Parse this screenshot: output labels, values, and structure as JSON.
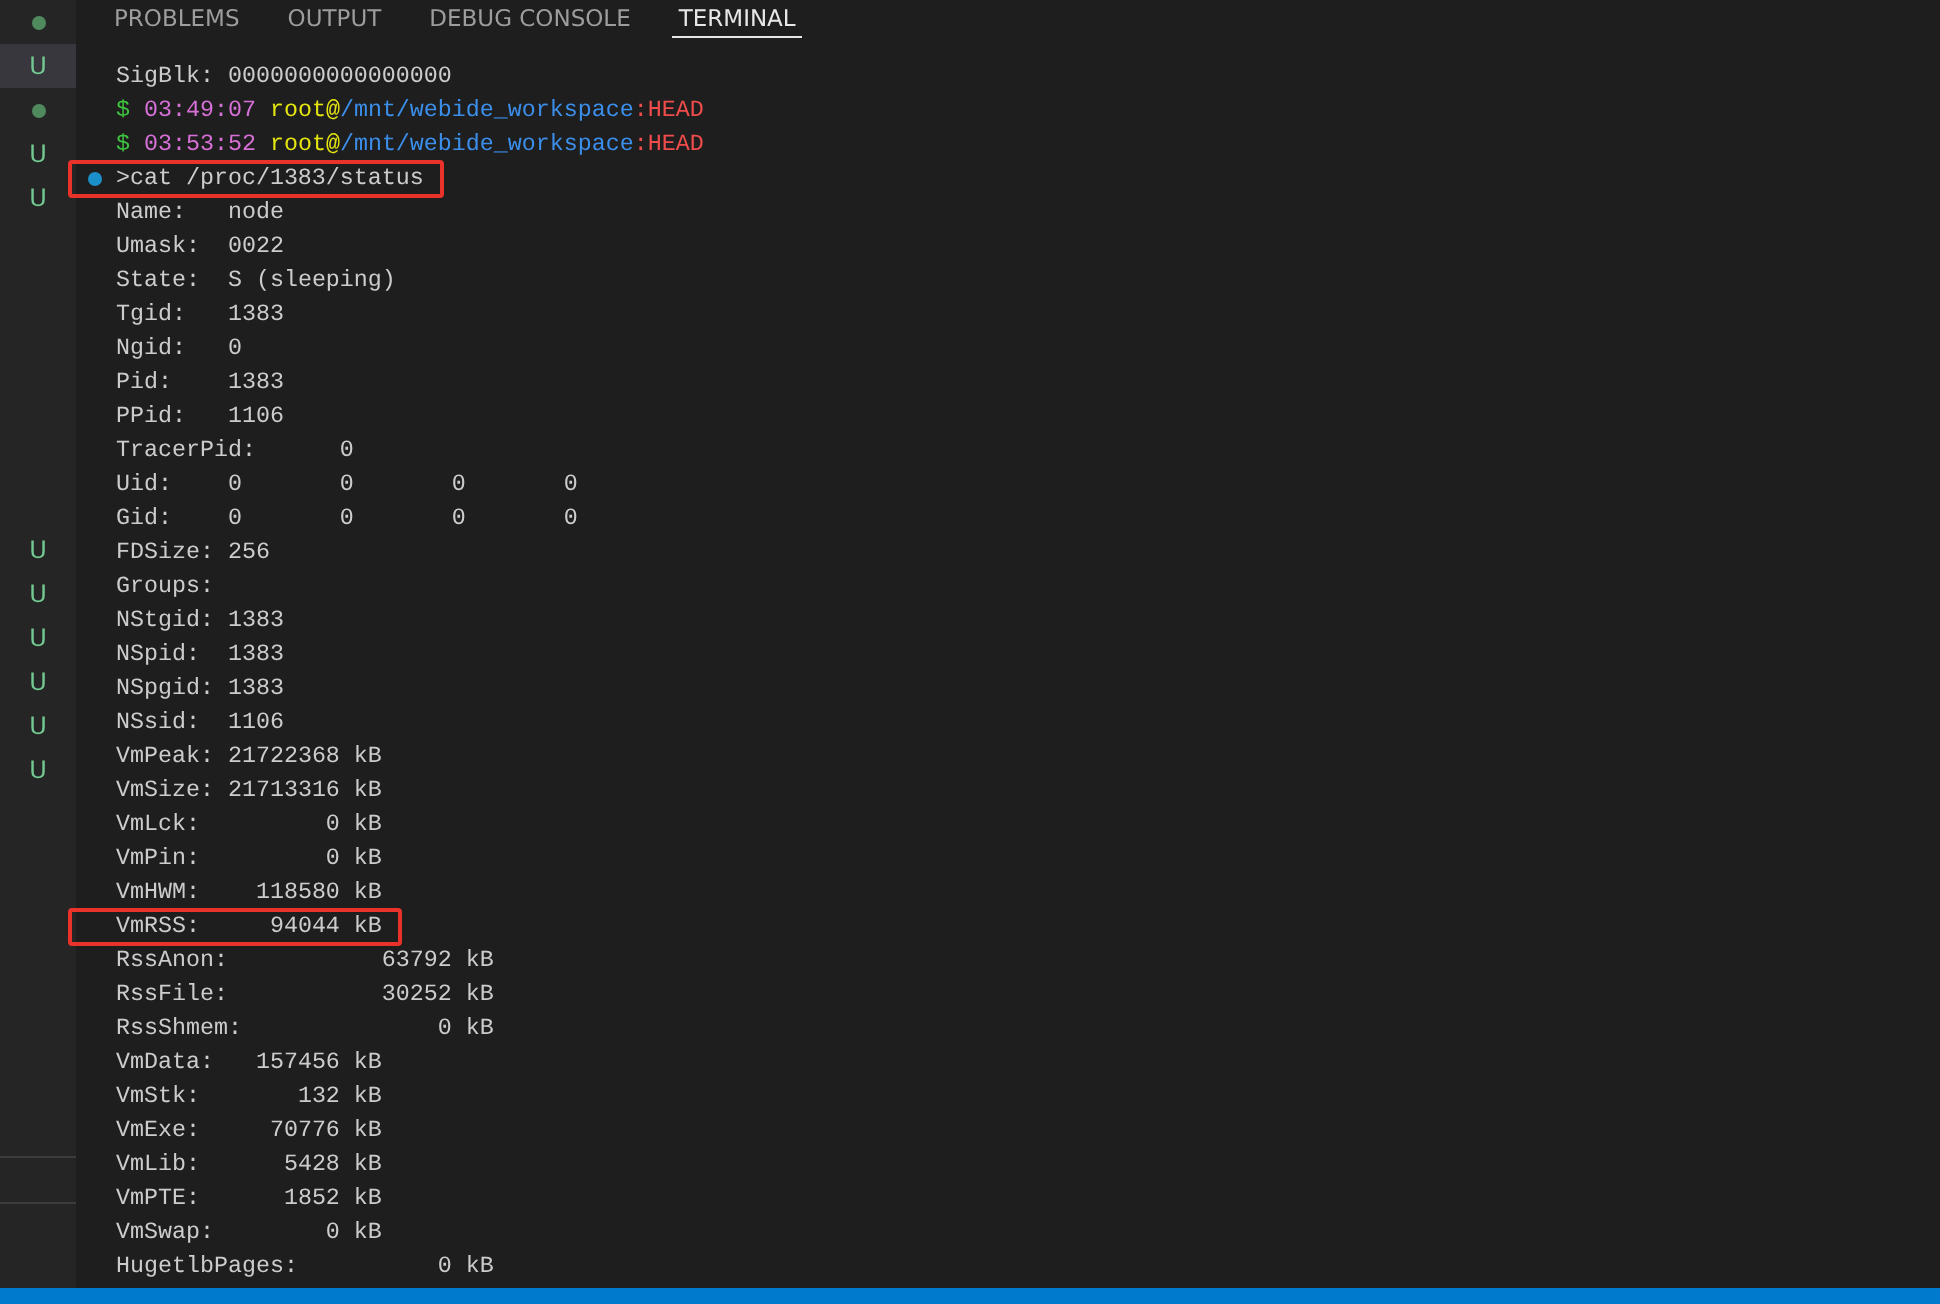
{
  "sidebar": {
    "groups": [
      {
        "items": [
          {
            "kind": "dot",
            "selected": false
          },
          {
            "kind": "letter",
            "text": "U",
            "selected": true
          },
          {
            "kind": "dot",
            "selected": false
          },
          {
            "kind": "letter",
            "text": "U",
            "selected": false
          },
          {
            "kind": "letter",
            "text": "U",
            "selected": false
          }
        ]
      },
      {
        "items": [
          {
            "kind": "letter",
            "text": "U",
            "selected": false
          },
          {
            "kind": "letter",
            "text": "U",
            "selected": false
          },
          {
            "kind": "letter",
            "text": "U",
            "selected": false
          },
          {
            "kind": "letter",
            "text": "U",
            "selected": false
          },
          {
            "kind": "letter",
            "text": "U",
            "selected": false
          },
          {
            "kind": "letter",
            "text": "U",
            "selected": false
          }
        ]
      }
    ]
  },
  "tabs": [
    {
      "label": "PROBLEMS",
      "selected": false
    },
    {
      "label": "OUTPUT",
      "selected": false
    },
    {
      "label": "DEBUG CONSOLE",
      "selected": false
    },
    {
      "label": "TERMINAL",
      "selected": true
    }
  ],
  "terminal": {
    "lines": [
      {
        "kind": "text",
        "text": "SigBlk:\t0000000000000000",
        "highlighted": false
      },
      {
        "kind": "prompt",
        "segments": [
          {
            "text": "$ ",
            "color": "#3fc43f"
          },
          {
            "text": "03:49:07 ",
            "color": "#d670d6"
          },
          {
            "text": "root@",
            "color": "#e5e510"
          },
          {
            "text": "/mnt/webide_workspace",
            "color": "#3b8eea"
          },
          {
            "text": ":HEAD",
            "color": "#f14c4c"
          }
        ],
        "highlighted": false
      },
      {
        "kind": "prompt",
        "segments": [
          {
            "text": "$ ",
            "color": "#3fc43f"
          },
          {
            "text": "03:53:52 ",
            "color": "#d670d6"
          },
          {
            "text": "root@",
            "color": "#e5e510"
          },
          {
            "text": "/mnt/webide_workspace",
            "color": "#3b8eea"
          },
          {
            "text": ":HEAD",
            "color": "#f14c4c"
          }
        ],
        "highlighted": false
      },
      {
        "kind": "command",
        "text": ">cat /proc/1383/status",
        "highlighted": true
      },
      {
        "kind": "text",
        "text": "Name:\tnode",
        "highlighted": false
      },
      {
        "kind": "text",
        "text": "Umask:\t0022",
        "highlighted": false
      },
      {
        "kind": "text",
        "text": "State:\tS (sleeping)",
        "highlighted": false
      },
      {
        "kind": "text",
        "text": "Tgid:\t1383",
        "highlighted": false
      },
      {
        "kind": "text",
        "text": "Ngid:\t0",
        "highlighted": false
      },
      {
        "kind": "text",
        "text": "Pid:\t1383",
        "highlighted": false
      },
      {
        "kind": "text",
        "text": "PPid:\t1106",
        "highlighted": false
      },
      {
        "kind": "text",
        "text": "TracerPid:\t0",
        "highlighted": false
      },
      {
        "kind": "text",
        "text": "Uid:\t0\t0\t0\t0",
        "highlighted": false
      },
      {
        "kind": "text",
        "text": "Gid:\t0\t0\t0\t0",
        "highlighted": false
      },
      {
        "kind": "text",
        "text": "FDSize:\t256",
        "highlighted": false
      },
      {
        "kind": "text",
        "text": "Groups:",
        "highlighted": false
      },
      {
        "kind": "text",
        "text": "NStgid:\t1383",
        "highlighted": false
      },
      {
        "kind": "text",
        "text": "NSpid:\t1383",
        "highlighted": false
      },
      {
        "kind": "text",
        "text": "NSpgid:\t1383",
        "highlighted": false
      },
      {
        "kind": "text",
        "text": "NSsid:\t1106",
        "highlighted": false
      },
      {
        "kind": "text",
        "text": "VmPeak:\t21722368 kB",
        "highlighted": false
      },
      {
        "kind": "text",
        "text": "VmSize:\t21713316 kB",
        "highlighted": false
      },
      {
        "kind": "text",
        "text": "VmLck:\t       0 kB",
        "highlighted": false
      },
      {
        "kind": "text",
        "text": "VmPin:\t       0 kB",
        "highlighted": false
      },
      {
        "kind": "text",
        "text": "VmHWM:\t  118580 kB",
        "highlighted": false
      },
      {
        "kind": "text",
        "text": "VmRSS:\t   94044 kB",
        "highlighted": true
      },
      {
        "kind": "text",
        "text": "RssAnon:\t   63792 kB",
        "highlighted": false
      },
      {
        "kind": "text",
        "text": "RssFile:\t   30252 kB",
        "highlighted": false
      },
      {
        "kind": "text",
        "text": "RssShmem:\t       0 kB",
        "highlighted": false
      },
      {
        "kind": "text",
        "text": "VmData:\t  157456 kB",
        "highlighted": false
      },
      {
        "kind": "text",
        "text": "VmStk:\t     132 kB",
        "highlighted": false
      },
      {
        "kind": "text",
        "text": "VmExe:\t   70776 kB",
        "highlighted": false
      },
      {
        "kind": "text",
        "text": "VmLib:\t    5428 kB",
        "highlighted": false
      },
      {
        "kind": "text",
        "text": "VmPTE:\t    1852 kB",
        "highlighted": false
      },
      {
        "kind": "text",
        "text": "VmSwap:\t       0 kB",
        "highlighted": false
      },
      {
        "kind": "text",
        "text": "HugetlbPages:\t       0 kB",
        "highlighted": false
      }
    ]
  }
}
